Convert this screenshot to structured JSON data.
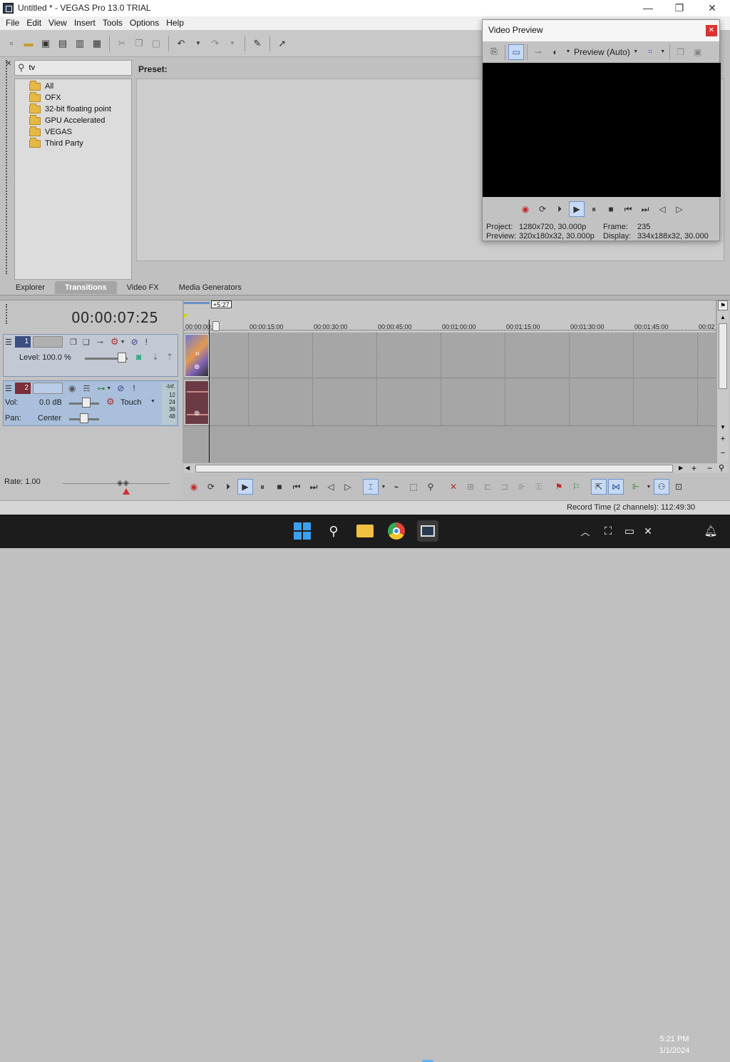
{
  "app": {
    "title": "Untitled * - VEGAS Pro 13.0 TRIAL",
    "win_minimize": "—",
    "win_restore": "❐",
    "win_close": "✕"
  },
  "menu": [
    "File",
    "Edit",
    "View",
    "Insert",
    "Tools",
    "Options",
    "Help"
  ],
  "search": {
    "value": "tv"
  },
  "tree": {
    "items": [
      "All",
      "OFX",
      "32-bit floating point",
      "GPU Accelerated",
      "VEGAS",
      "Third Party"
    ]
  },
  "preset": {
    "label": "Preset:"
  },
  "tabs": [
    {
      "label": "Explorer",
      "active": false
    },
    {
      "label": "Transitions",
      "active": true
    },
    {
      "label": "Video FX",
      "active": false
    },
    {
      "label": "Media Generators",
      "active": false
    }
  ],
  "timeline": {
    "timecode": "00:00:07:25",
    "offset_label": "+5:27",
    "ruler_labels": [
      "00:00:00;00",
      "00:00:15:00",
      "00:00:30:00",
      "00:00:45:00",
      "00:01:00:00",
      "00:01:15:00",
      "00:01:30:00",
      "00:01:45:00",
      "00:02"
    ],
    "track1": {
      "number": "1",
      "level_label": "Level: 100.0 %"
    },
    "track2": {
      "number": "2",
      "vol_label": "Vol:",
      "vol_value": "0.0 dB",
      "pan_label": "Pan:",
      "pan_value": "Center",
      "automation": "Touch",
      "meter_labels": [
        "-Inf.",
        "12",
        "24",
        "36",
        "48"
      ]
    },
    "rate_label": "Rate: 1.00"
  },
  "status": {
    "record_time": "Record Time (2 channels): 112:49:30"
  },
  "video_preview": {
    "title": "Video Preview",
    "quality": "Preview (Auto)",
    "project_label": "Project:",
    "project_value": "1280x720, 30.000p",
    "preview_label": "Preview:",
    "preview_value": "320x180x32, 30.000p",
    "frame_label": "Frame:",
    "frame_value": "235",
    "display_label": "Display:",
    "display_value": "334x188x32, 30.000"
  },
  "taskbar": {
    "time": "5:21 PM",
    "date": "1/1/2024"
  }
}
